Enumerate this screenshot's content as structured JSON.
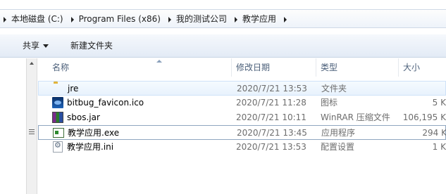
{
  "breadcrumb": {
    "items": [
      "本地磁盘 (C:)",
      "Program Files (x86)",
      "我的测试公司",
      "教学应用"
    ]
  },
  "toolbar": {
    "share_label": "共享",
    "new_folder_label": "新建文件夹"
  },
  "columns": {
    "name": "名称",
    "date": "修改日期",
    "type": "类型",
    "size": "大小"
  },
  "files": [
    {
      "name": "jre",
      "date": "2020/7/21 13:53",
      "type": "文件夹",
      "size": "",
      "icon": "folder-icon"
    },
    {
      "name": "bitbug_favicon.ico",
      "date": "2020/7/21 11:28",
      "type": "图标",
      "size": "5 K",
      "icon": "image-icon"
    },
    {
      "name": "sbos.jar",
      "date": "2020/7/21 10:11",
      "type": "WinRAR 压缩文件",
      "size": "106,195 K",
      "icon": "archive-icon"
    },
    {
      "name": "教学应用.exe",
      "date": "2020/7/21 13:45",
      "type": "应用程序",
      "size": "294 K",
      "icon": "application-icon"
    },
    {
      "name": "教学应用.ini",
      "date": "2020/7/21 13:53",
      "type": "配置设置",
      "size": "1 K",
      "icon": "settings-file-icon"
    }
  ]
}
